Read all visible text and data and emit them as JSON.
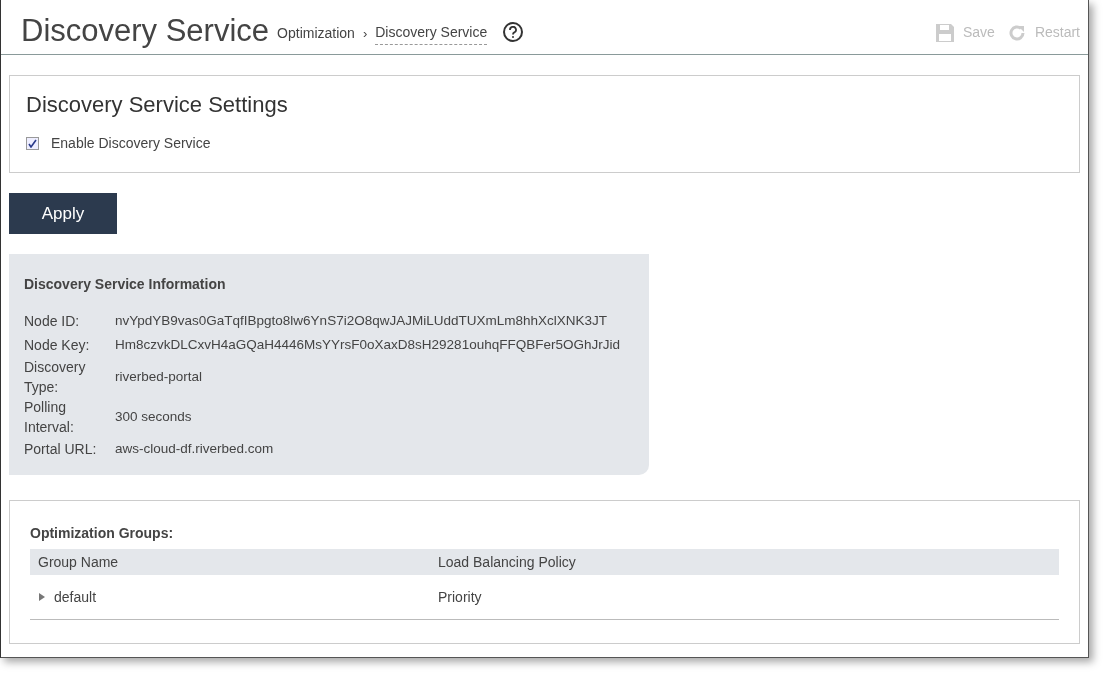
{
  "header": {
    "title": "Discovery Service",
    "breadcrumb_separator": "›",
    "breadcrumb": [
      {
        "label": "Optimization",
        "current": false
      },
      {
        "label": "Discovery Service",
        "current": true
      }
    ],
    "actions": [
      {
        "kind": "save",
        "label": "Save",
        "disabled": true
      },
      {
        "kind": "restart",
        "label": "Restart",
        "disabled": true
      }
    ]
  },
  "settings": {
    "title": "Discovery Service Settings",
    "checkbox": {
      "label": "Enable Discovery Service",
      "checked": true
    }
  },
  "apply_button": "Apply",
  "info": {
    "title": "Discovery Service Information",
    "rows": [
      {
        "label": "Node ID:",
        "value": "nvYpdYB9vas0GaTqfIBpgto8lw6YnS7i2O8qwJAJMiLUddTUXmLm8hhXclXNK3JT"
      },
      {
        "label": "Node Key:",
        "value": "Hm8czvkDLCxvH4aGQaH4446MsYYrsF0oXaxD8sH29281ouhqFFQBFer5OGhJrJid"
      },
      {
        "label": "Discovery Type:",
        "value": "riverbed-portal"
      },
      {
        "label": "Polling Interval:",
        "value": "300 seconds"
      },
      {
        "label": "Portal URL:",
        "value": "aws-cloud-df.riverbed.com"
      }
    ]
  },
  "groups": {
    "title": "Optimization Groups:",
    "columns": [
      "Group Name",
      "Load Balancing Policy"
    ],
    "rows": [
      {
        "name": "default",
        "policy": "Priority",
        "expanded": false
      }
    ]
  }
}
